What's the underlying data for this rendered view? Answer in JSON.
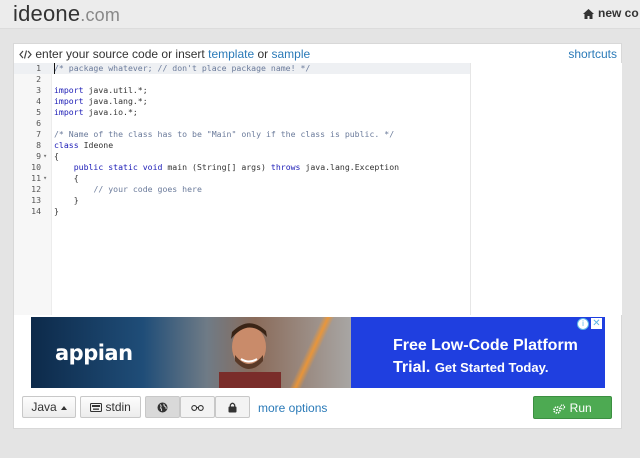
{
  "header": {
    "logo_main": "ideone",
    "logo_tld": ".com",
    "new_code_label": "new co"
  },
  "editor_hint": {
    "prefix": "enter your source code or insert",
    "template_link": "template",
    "or_text": "or",
    "sample_link": "sample",
    "shortcuts_link": "shortcuts"
  },
  "code_lines": [
    {
      "n": "1",
      "fold": "",
      "tokens": [
        {
          "t": "/* package whatever; // don't place package name! */",
          "c": "cm"
        }
      ]
    },
    {
      "n": "2",
      "fold": "",
      "tokens": []
    },
    {
      "n": "3",
      "fold": "",
      "tokens": [
        {
          "t": "import",
          "c": "kw"
        },
        {
          "t": " java.util.*;",
          "c": ""
        }
      ]
    },
    {
      "n": "4",
      "fold": "",
      "tokens": [
        {
          "t": "import",
          "c": "kw"
        },
        {
          "t": " java.lang.*;",
          "c": ""
        }
      ]
    },
    {
      "n": "5",
      "fold": "",
      "tokens": [
        {
          "t": "import",
          "c": "kw"
        },
        {
          "t": " java.io.*;",
          "c": ""
        }
      ]
    },
    {
      "n": "6",
      "fold": "",
      "tokens": []
    },
    {
      "n": "7",
      "fold": "",
      "tokens": [
        {
          "t": "/* Name of the class has to be \"Main\" only if the class is public. */",
          "c": "cm"
        }
      ]
    },
    {
      "n": "8",
      "fold": "",
      "tokens": [
        {
          "t": "class",
          "c": "kw"
        },
        {
          "t": " Ideone",
          "c": ""
        }
      ]
    },
    {
      "n": "9",
      "fold": "▾",
      "tokens": [
        {
          "t": "{",
          "c": ""
        }
      ]
    },
    {
      "n": "10",
      "fold": "",
      "tokens": [
        {
          "t": "    ",
          "c": ""
        },
        {
          "t": "public static void",
          "c": "kw"
        },
        {
          "t": " main (String[] args) ",
          "c": ""
        },
        {
          "t": "throws",
          "c": "kw"
        },
        {
          "t": " java.lang.Exception",
          "c": ""
        }
      ]
    },
    {
      "n": "11",
      "fold": "▾",
      "tokens": [
        {
          "t": "    {",
          "c": ""
        }
      ]
    },
    {
      "n": "12",
      "fold": "",
      "tokens": [
        {
          "t": "        ",
          "c": ""
        },
        {
          "t": "// your code goes here",
          "c": "cm"
        }
      ]
    },
    {
      "n": "13",
      "fold": "",
      "tokens": [
        {
          "t": "    }",
          "c": ""
        }
      ]
    },
    {
      "n": "14",
      "fold": "",
      "tokens": [
        {
          "t": "}",
          "c": ""
        }
      ]
    }
  ],
  "ad": {
    "brand": "appian",
    "headline": "Free Low-Code Platform",
    "sub_bold": "Trial.",
    "sub_small": "Get Started Today.",
    "info_icon": "i",
    "close_icon": "✕"
  },
  "toolbar": {
    "language_label": "Java",
    "stdin_label": "stdin",
    "more_options_label": "more options",
    "run_label": "Run"
  },
  "colors": {
    "link": "#2a7ab8",
    "run_green": "#4daa52",
    "ad_blue": "#1f3fe0",
    "keyword": "#1b1bb6",
    "comment": "#6b7b9b"
  },
  "icons": {
    "code_icon": "code-icon",
    "home_icon": "home-icon",
    "keyboard_icon": "keyboard-icon",
    "globe_icon": "globe-icon",
    "glasses_icon": "glasses-icon",
    "lock_icon": "lock-icon",
    "gears_icon": "gears-icon"
  }
}
